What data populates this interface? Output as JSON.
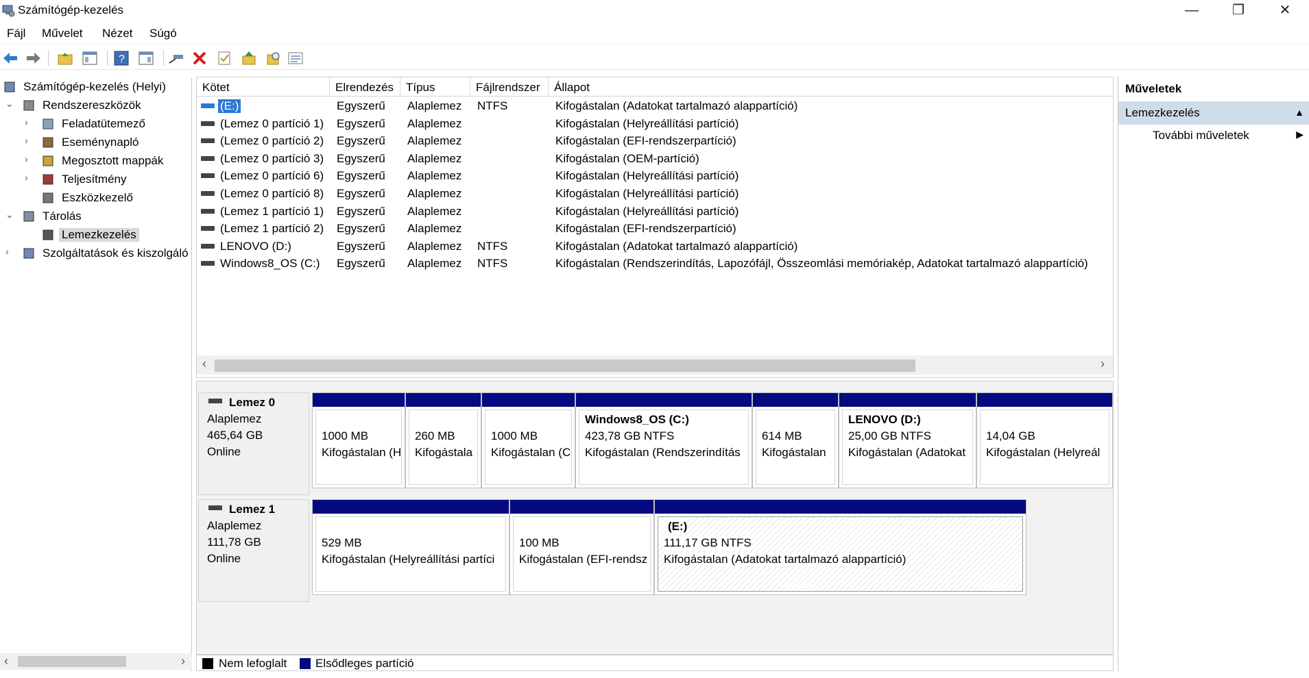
{
  "window": {
    "title": "Számítógép-kezelés",
    "controls": {
      "minimize": "—",
      "restore": "❐",
      "close": "✕"
    }
  },
  "menu": [
    "Fájl",
    "Művelet",
    "Nézet",
    "Súgó"
  ],
  "toolbar": [
    "back-icon",
    "forward-icon",
    "up-folder-icon",
    "show-hide-tree-icon",
    "help-icon",
    "show-hide-action-pane-icon",
    "connect-icon",
    "delete-icon",
    "properties-icon",
    "import-icon",
    "search-icon",
    "details-icon"
  ],
  "tree": {
    "items": [
      {
        "label": "Számítógép-kezelés (Helyi)",
        "icon": "computer-management-icon",
        "toggle": ""
      },
      {
        "label": "Rendszereszközök",
        "icon": "tools-icon",
        "toggle": "⌄"
      },
      {
        "label": "Feladatütemező",
        "icon": "clock-icon",
        "toggle": "›"
      },
      {
        "label": "Eseménynapló",
        "icon": "event-viewer-icon",
        "toggle": "›"
      },
      {
        "label": "Megosztott mappák",
        "icon": "shared-folders-icon",
        "toggle": "›"
      },
      {
        "label": "Teljesítmény",
        "icon": "performance-icon",
        "toggle": "›"
      },
      {
        "label": "Eszközkezelő",
        "icon": "device-manager-icon",
        "toggle": ""
      },
      {
        "label": "Tárolás",
        "icon": "storage-icon",
        "toggle": "⌄"
      },
      {
        "label": "Lemezkezelés",
        "icon": "disk-management-icon",
        "toggle": ""
      },
      {
        "label": "Szolgáltatások és kiszolgáló",
        "icon": "services-icon",
        "toggle": "›"
      }
    ],
    "scroll": {
      "left": "‹",
      "right": "›"
    }
  },
  "volume_table": {
    "columns": [
      "Kötet",
      "Elrendezés",
      "Típus",
      "Fájlrendszer",
      "Állapot"
    ],
    "rows": [
      {
        "volume": "(E:)",
        "layout": "Egyszerű",
        "type": "Alaplemez",
        "fs": "NTFS",
        "status": "Kifogástalan (Adatokat tartalmazó alappartíció)"
      },
      {
        "volume": "(Lemez 0 partíció 1)",
        "layout": "Egyszerű",
        "type": "Alaplemez",
        "fs": "",
        "status": "Kifogástalan (Helyreállítási partíció)"
      },
      {
        "volume": "(Lemez 0 partíció 2)",
        "layout": "Egyszerű",
        "type": "Alaplemez",
        "fs": "",
        "status": "Kifogástalan (EFI-rendszerpartíció)"
      },
      {
        "volume": "(Lemez 0 partíció 3)",
        "layout": "Egyszerű",
        "type": "Alaplemez",
        "fs": "",
        "status": "Kifogástalan (OEM-partíció)"
      },
      {
        "volume": "(Lemez 0 partíció 6)",
        "layout": "Egyszerű",
        "type": "Alaplemez",
        "fs": "",
        "status": "Kifogástalan (Helyreállítási partíció)"
      },
      {
        "volume": "(Lemez 0 partíció 8)",
        "layout": "Egyszerű",
        "type": "Alaplemez",
        "fs": "",
        "status": "Kifogástalan (Helyreállítási partíció)"
      },
      {
        "volume": "(Lemez 1 partíció 1)",
        "layout": "Egyszerű",
        "type": "Alaplemez",
        "fs": "",
        "status": "Kifogástalan (Helyreállítási partíció)"
      },
      {
        "volume": "(Lemez 1 partíció 2)",
        "layout": "Egyszerű",
        "type": "Alaplemez",
        "fs": "",
        "status": "Kifogástalan (EFI-rendszerpartíció)"
      },
      {
        "volume": "LENOVO (D:)",
        "layout": "Egyszerű",
        "type": "Alaplemez",
        "fs": "NTFS",
        "status": "Kifogástalan (Adatokat tartalmazó alappartíció)"
      },
      {
        "volume": "Windows8_OS (C:)",
        "layout": "Egyszerű",
        "type": "Alaplemez",
        "fs": "NTFS",
        "status": "Kifogástalan (Rendszerindítás, Lapozófájl, Összeomlási memóriakép, Adatokat tartalmazó alappartíció)"
      }
    ],
    "scroll": {
      "left": "‹",
      "right": "›"
    }
  },
  "disks": [
    {
      "name": "Lemez 0",
      "type": "Alaplemez",
      "size": "465,64 GB",
      "state": "Online",
      "partitions": [
        {
          "title": "",
          "size": "1000 MB",
          "status": "Kifogástalan (H"
        },
        {
          "title": "",
          "size": "260 MB",
          "status": "Kifogástala"
        },
        {
          "title": "",
          "size": "1000 MB",
          "status": "Kifogástalan (C"
        },
        {
          "title": "Windows8_OS  (C:)",
          "size": "423,78 GB NTFS",
          "status": "Kifogástalan (Rendszerindítás"
        },
        {
          "title": "",
          "size": "614 MB",
          "status": "Kifogástalan"
        },
        {
          "title": "LENOVO  (D:)",
          "size": "25,00 GB NTFS",
          "status": "Kifogástalan (Adatokat"
        },
        {
          "title": "",
          "size": "14,04 GB",
          "status": "Kifogástalan (Helyreál"
        }
      ]
    },
    {
      "name": "Lemez 1",
      "type": "Alaplemez",
      "size": "111,78 GB",
      "state": "Online",
      "partitions": [
        {
          "title": "",
          "size": "529 MB",
          "status": "Kifogástalan (Helyreállítási partíci"
        },
        {
          "title": "",
          "size": "100 MB",
          "status": "Kifogástalan (EFI-rendsz"
        },
        {
          "title": "(E:)",
          "size": "111,17 GB NTFS",
          "status": "Kifogástalan (Adatokat tartalmazó alappartíció)"
        }
      ]
    }
  ],
  "legend": [
    {
      "label": "Nem lefoglalt",
      "color": "#000000"
    },
    {
      "label": "Elsődleges partíció",
      "color": "#050a80"
    }
  ],
  "actions": {
    "header": "Műveletek",
    "section": "Lemezkezelés",
    "section_arrow": "▲",
    "more": "További műveletek",
    "more_arrow": "▶"
  }
}
